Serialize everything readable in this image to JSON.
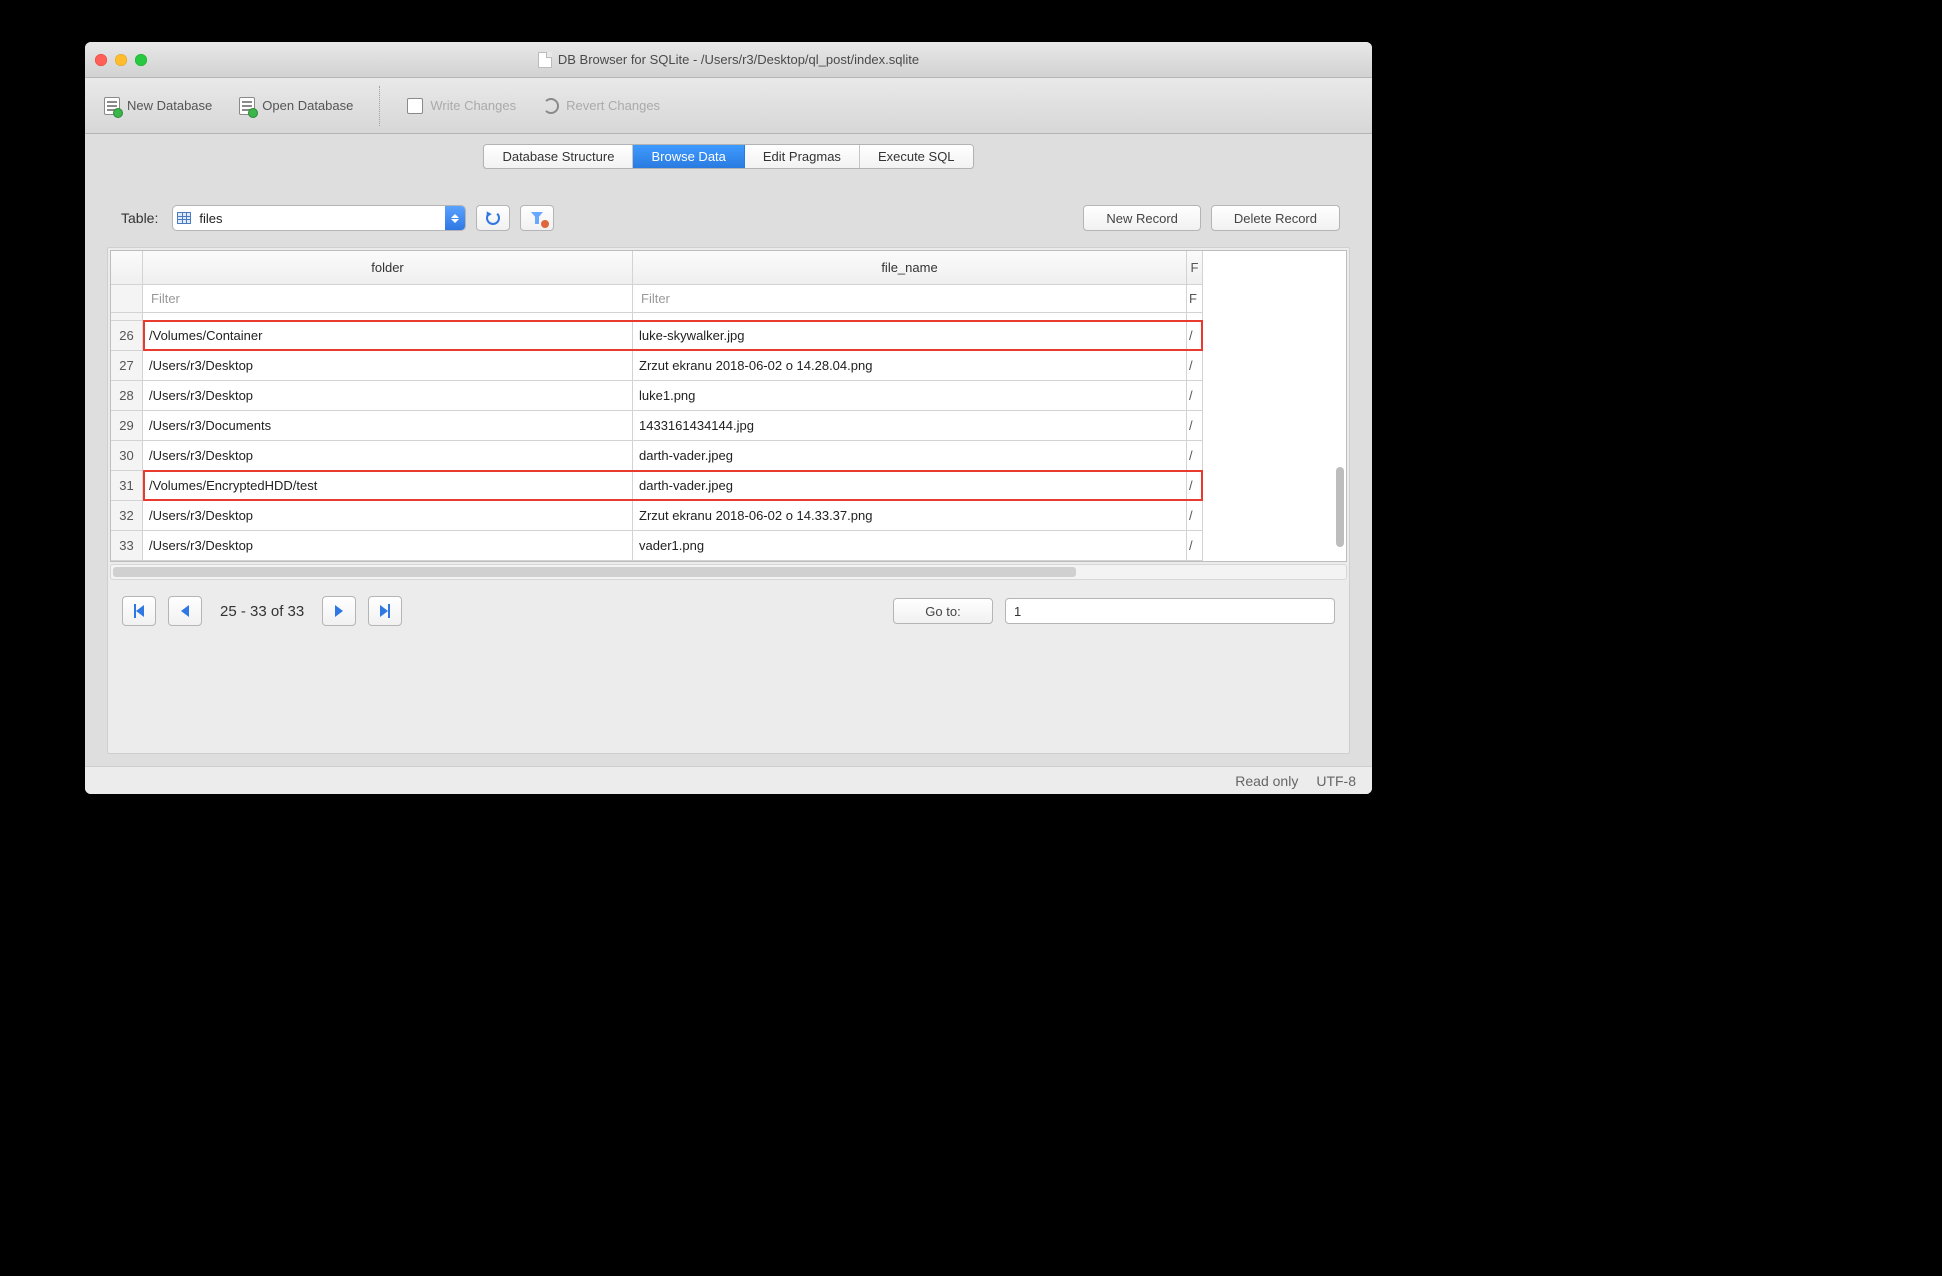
{
  "window": {
    "title": "DB Browser for SQLite - /Users/r3/Desktop/ql_post/index.sqlite"
  },
  "toolbar": {
    "new_database": "New Database",
    "open_database": "Open Database",
    "write_changes": "Write Changes",
    "revert_changes": "Revert Changes"
  },
  "tabs": {
    "database_structure": "Database Structure",
    "browse_data": "Browse Data",
    "edit_pragmas": "Edit Pragmas",
    "execute_sql": "Execute SQL",
    "active": "browse_data"
  },
  "browse": {
    "table_label": "Table:",
    "table_selected": "files",
    "new_record": "New Record",
    "delete_record": "Delete Record"
  },
  "grid": {
    "columns": {
      "c1": "folder",
      "c2": "file_name",
      "c3_stub": "F"
    },
    "filter_placeholder": "Filter",
    "right_stub": "/",
    "rows": [
      {
        "n": "26",
        "folder": "/Volumes/Container",
        "file": "luke-skywalker.jpg",
        "hl": true
      },
      {
        "n": "27",
        "folder": "/Users/r3/Desktop",
        "file": "Zrzut ekranu 2018-06-02 o 14.28.04.png",
        "hl": false
      },
      {
        "n": "28",
        "folder": "/Users/r3/Desktop",
        "file": "luke1.png",
        "hl": false
      },
      {
        "n": "29",
        "folder": "/Users/r3/Documents",
        "file": "1433161434144.jpg",
        "hl": false
      },
      {
        "n": "30",
        "folder": "/Users/r3/Desktop",
        "file": "darth-vader.jpeg",
        "hl": false
      },
      {
        "n": "31",
        "folder": "/Volumes/EncryptedHDD/test",
        "file": "darth-vader.jpeg",
        "hl": true
      },
      {
        "n": "32",
        "folder": "/Users/r3/Desktop",
        "file": "Zrzut ekranu 2018-06-02 o 14.33.37.png",
        "hl": false
      },
      {
        "n": "33",
        "folder": "/Users/r3/Desktop",
        "file": "vader1.png",
        "hl": false
      }
    ]
  },
  "pager": {
    "range_text": "25 - 33 of 33",
    "goto_label": "Go to:",
    "goto_value": "1"
  },
  "status": {
    "readonly": "Read only",
    "encoding": "UTF-8"
  }
}
